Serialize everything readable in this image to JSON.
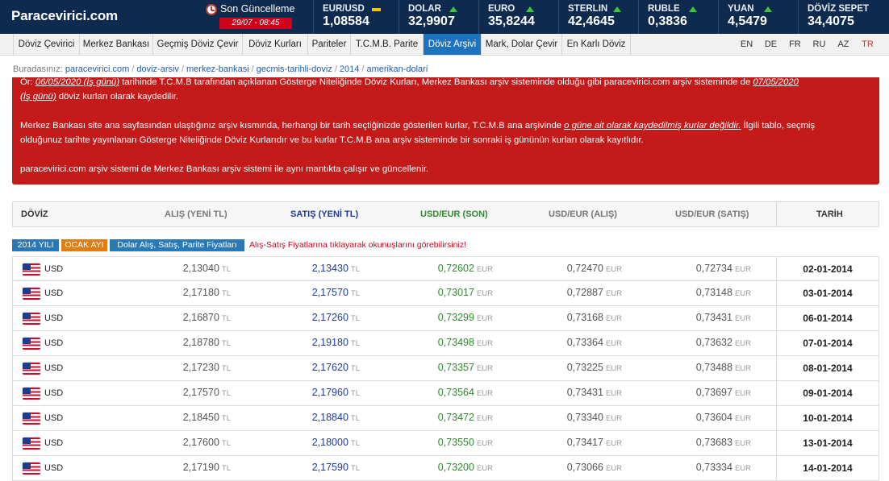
{
  "site": {
    "logo": "Paracevirici.com"
  },
  "last_update": {
    "label": "Son Güncelleme",
    "time": "29/07 - 08:45"
  },
  "tickers": [
    {
      "name": "EUR/USD",
      "value": "1,08584",
      "trend": "flat"
    },
    {
      "name": "DOLAR",
      "value": "32,9907",
      "trend": "up"
    },
    {
      "name": "EURO",
      "value": "35,8244",
      "trend": "up"
    },
    {
      "name": "STERLIN",
      "value": "42,4645",
      "trend": "up"
    },
    {
      "name": "RUBLE",
      "value": "0,3836",
      "trend": "up"
    },
    {
      "name": "YUAN",
      "value": "4,5479",
      "trend": "up"
    },
    {
      "name": "DÖVİZ SEPET",
      "value": "34,4075",
      "trend": "none"
    }
  ],
  "nav": [
    "Döviz Çevirici",
    "Merkez Bankası",
    "Geçmiş Döviz Çevir",
    "Döviz Kurları",
    "Pariteler",
    "T.C.M.B. Parite",
    "Döviz Arşivi",
    "Mark, Dolar Çevir",
    "En Karlı Döviz"
  ],
  "languages": [
    "EN",
    "DE",
    "FR",
    "RU",
    "AZ",
    "TR"
  ],
  "breadcrumb": {
    "label": "Buradasınız:",
    "items": [
      "paracevirici.com",
      "doviz-arsiv",
      "merkez-bankasi",
      "gecmis-tarihli-doviz",
      "2014",
      "amerikan-dolari"
    ]
  },
  "notice": {
    "line1a": "Ör: ",
    "line1b": "06/05/2020 (İş günü)",
    "line1c": " tarihinde T.C.M.B tarafından açıklanan Gösterge Niteliğinde Döviz Kurları, Merkez Bankası arşiv sisteminde olduğu gibi paracevirici.com arşiv sisteminde de ",
    "line1d": "07/05/2020",
    "line2a": "(İş günü)",
    "line2b": " döviz kurları olarak kaydedilir.",
    "para2a": "Merkez Bankası site ana sayfasından ulaştığınız arşiv kısmında, herhangi bir tarih seçtiğinizde gösterilen kurlar, T.C.M.B ana arşivinde ",
    "para2b": "o güne ait olarak kaydedilmiş kurlar değildir.",
    "para2c": " İlgili tablo, seçmiş",
    "para2d": "olduğunuz tarihte yayınlanan Gösterge Niteliğinde Döviz Kurlarıdır ve bu kurlar T.C.M.B ana arşiv sisteminde bir sonraki iş gününün kurları olarak kayıtlıdır.",
    "para3": "paracevirici.com arşiv sistemi de Merkez Bankası arşiv sistemi ile aynı mantıkta çalışır ve güncellenir."
  },
  "table": {
    "headers": {
      "doviz": "DÖVİZ",
      "alis": "ALIŞ (YENİ TL)",
      "satis": "SATIŞ (YENİ TL)",
      "son": "USD/EUR (SON)",
      "alis2": "USD/EUR (ALIŞ)",
      "satis2": "USD/EUR (SATIŞ)",
      "tarih": "TARİH"
    },
    "tags": {
      "year": "2014 YILI",
      "month": "OCAK AYI",
      "info": "Dolar Alış, Satış, Parite Fiyatları",
      "note": "Alış-Satış Fiyatlarına tıklayarak okunuşlarını görebilirsiniz!"
    },
    "unit_tl": "TL",
    "unit_eur": "EUR",
    "rows": [
      {
        "code": "USD",
        "alis": "2,13040",
        "satis": "2,13430",
        "son": "0,72602",
        "palis": "0,72470",
        "psatis": "0,72734",
        "date": "02-01-2014"
      },
      {
        "code": "USD",
        "alis": "2,17180",
        "satis": "2,17570",
        "son": "0,73017",
        "palis": "0,72887",
        "psatis": "0,73148",
        "date": "03-01-2014"
      },
      {
        "code": "USD",
        "alis": "2,16870",
        "satis": "2,17260",
        "son": "0,73299",
        "palis": "0,73168",
        "psatis": "0,73431",
        "date": "06-01-2014"
      },
      {
        "code": "USD",
        "alis": "2,18780",
        "satis": "2,19180",
        "son": "0,73498",
        "palis": "0,73364",
        "psatis": "0,73632",
        "date": "07-01-2014"
      },
      {
        "code": "USD",
        "alis": "2,17230",
        "satis": "2,17620",
        "son": "0,73357",
        "palis": "0,73225",
        "psatis": "0,73488",
        "date": "08-01-2014"
      },
      {
        "code": "USD",
        "alis": "2,17570",
        "satis": "2,17960",
        "son": "0,73564",
        "palis": "0,73431",
        "psatis": "0,73697",
        "date": "09-01-2014"
      },
      {
        "code": "USD",
        "alis": "2,18450",
        "satis": "2,18840",
        "son": "0,73472",
        "palis": "0,73340",
        "psatis": "0,73604",
        "date": "10-01-2014"
      },
      {
        "code": "USD",
        "alis": "2,17600",
        "satis": "2,18000",
        "son": "0,73550",
        "palis": "0,73417",
        "psatis": "0,73683",
        "date": "13-01-2014"
      },
      {
        "code": "USD",
        "alis": "2,17190",
        "satis": "2,17590",
        "son": "0,73200",
        "palis": "0,73066",
        "psatis": "0,73334",
        "date": "14-01-2014"
      }
    ]
  }
}
